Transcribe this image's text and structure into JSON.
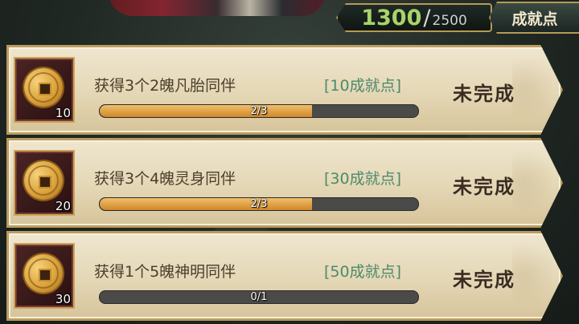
{
  "header": {
    "current_points": "1300",
    "separator": "/",
    "max_points": "2500",
    "title": "成就点"
  },
  "achievements": [
    {
      "name": "获得3个2魄凡胎同伴",
      "points": "[10成就点]",
      "reward_count": "10",
      "progress_text": "2/3",
      "progress": 0.667,
      "status": "未完成",
      "icon": "copper-coin-icon"
    },
    {
      "name": "获得3个4魄灵身同伴",
      "points": "[30成就点]",
      "reward_count": "20",
      "progress_text": "2/3",
      "progress": 0.667,
      "status": "未完成",
      "icon": "copper-coin-icon"
    },
    {
      "name": "获得1个5魄神明同伴",
      "points": "[50成就点]",
      "reward_count": "30",
      "progress_text": "0/1",
      "progress": 0.0,
      "status": "未完成",
      "icon": "copper-coin-icon"
    }
  ],
  "colors": {
    "points_green": "#a8d36a",
    "fill_orange": "#d1862a",
    "reward_green": "#4d8a6c"
  }
}
